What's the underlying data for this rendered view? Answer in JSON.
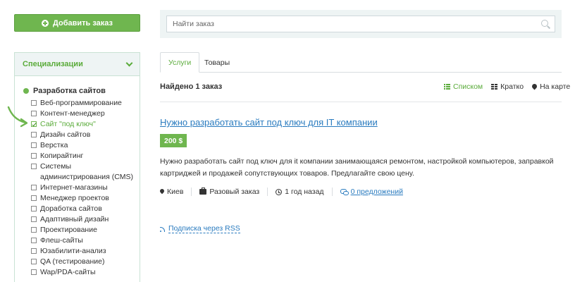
{
  "sidebar": {
    "add_button_label": "Добавить заказ",
    "specializations_title": "Специализации",
    "category": "Разработка сайтов",
    "items": [
      {
        "label": "Веб-программирование",
        "checked": false
      },
      {
        "label": "Контент-менеджер",
        "checked": false
      },
      {
        "label": "Сайт \"под ключ\"",
        "checked": true
      },
      {
        "label": "Дизайн сайтов",
        "checked": false
      },
      {
        "label": "Верстка",
        "checked": false
      },
      {
        "label": "Копирайтинг",
        "checked": false
      },
      {
        "label": "Системы администрирования (CMS)",
        "checked": false
      },
      {
        "label": "Интернет-магазины",
        "checked": false
      },
      {
        "label": "Менеджер проектов",
        "checked": false
      },
      {
        "label": "Доработка сайтов",
        "checked": false
      },
      {
        "label": "Адаптивный дизайн",
        "checked": false
      },
      {
        "label": "Проектирование",
        "checked": false
      },
      {
        "label": "Флеш-сайты",
        "checked": false
      },
      {
        "label": "Юзабилити-анализ",
        "checked": false
      },
      {
        "label": "QA (тестирование)",
        "checked": false
      },
      {
        "label": "Wap/PDA-сайты",
        "checked": false
      }
    ]
  },
  "search": {
    "placeholder": "Найти заказ",
    "value": ""
  },
  "tabs": [
    {
      "label": "Услуги",
      "active": true
    },
    {
      "label": "Товары",
      "active": false
    }
  ],
  "results": {
    "found_text": "Найдено 1 заказ",
    "views": [
      {
        "label": "Списком",
        "icon": "list-icon",
        "active": true
      },
      {
        "label": "Кратко",
        "icon": "grid-icon",
        "active": false
      },
      {
        "label": "На карте",
        "icon": "map-pin-icon",
        "active": false
      }
    ]
  },
  "order": {
    "title": "Нужно разработать сайт под ключ для IT компании",
    "price": "200 $",
    "description": "Нужно разработать сайт под ключ для it компании занимающаяся ремонтом, настройкой компьютеров, заправкой картриджей и продажей сопутствующих товаров. Предлагайте свою цену.",
    "location": "Киев",
    "type": "Разовый заказ",
    "time_ago": "1 год назад",
    "offers": "0 предложений"
  },
  "rss_label": "Подписка через RSS",
  "colors": {
    "accent_green": "#6fb64f",
    "link_blue": "#2a7bbf",
    "panel_bg": "#eef4f4"
  }
}
